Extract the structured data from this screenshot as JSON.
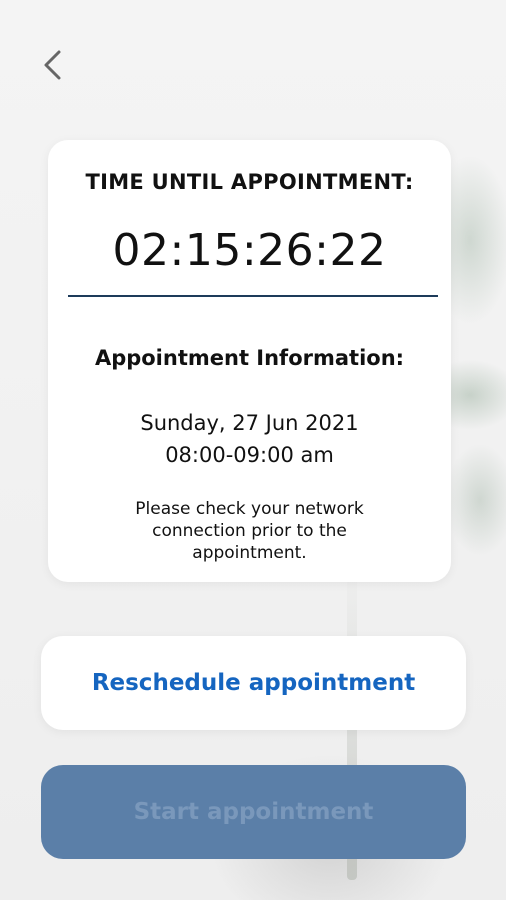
{
  "header": {
    "back_icon": "chevron-left-icon"
  },
  "countdown_card": {
    "title": "TIME UNTIL APPOINTMENT:",
    "countdown": "02:15:26:22",
    "divider_color": "#1d3b5a",
    "info_title": "Appointment Information:",
    "date": "Sunday, 27 Jun 2021",
    "time": "08:00-09:00 am",
    "notice": "Please check your network connection prior to the appointment."
  },
  "actions": {
    "reschedule_label": "Reschedule appointment",
    "reschedule_color": "#1565c0",
    "start_label": "Start appointment",
    "start_background": "#5b7fa8",
    "start_disabled": true
  }
}
